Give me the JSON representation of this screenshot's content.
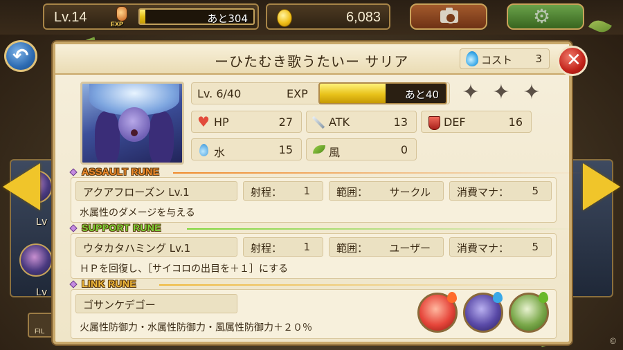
{
  "hud": {
    "level": "Lv.14",
    "exp_icon_label": "EXP",
    "exp_remaining": "あと304",
    "exp_fill_fraction": 0.05,
    "coins": "6,083"
  },
  "background": {
    "left_levels": [
      "Lv",
      "Lv"
    ],
    "filter_label": "FIL"
  },
  "card": {
    "title": "ーひたむき歌うたいー サリア",
    "cost_label": "コスト",
    "cost_value": "3",
    "level": "Lv. 6/40",
    "exp_label": "EXP",
    "exp_remaining": "あと40",
    "exp_fill_fraction": 0.52,
    "stars_filled": 0,
    "stars_total": 3,
    "stats": {
      "hp_label": "HP",
      "hp_value": "27",
      "atk_label": "ATK",
      "atk_value": "13",
      "def_label": "DEF",
      "def_value": "16",
      "water_label": "水",
      "water_value": "15",
      "wind_label": "風",
      "wind_value": "0"
    }
  },
  "assault_rune": {
    "tag": "ASSAULT RUNE",
    "name": "アクアフローズン Lv.1",
    "range_label": "射程：",
    "range_value": "1",
    "area_label": "範囲：",
    "area_value": "サークル",
    "mana_label": "消費マナ：",
    "mana_value": "5",
    "description": "水属性のダメージを与える"
  },
  "support_rune": {
    "tag": "SUPPORT RUNE",
    "name": "ウタカタハミング Lv.1",
    "range_label": "射程：",
    "range_value": "1",
    "area_label": "範囲：",
    "area_value": "ユーザー",
    "mana_label": "消費マナ：",
    "mana_value": "5",
    "description": "ＨＰを回復し、［サイコロの出目を＋１］にする"
  },
  "link_rune": {
    "tag": "LINK RUNE",
    "name": "ゴサンケデゴー",
    "description": "火属性防御力・水属性防御力・風属性防御力＋２０％"
  },
  "colors": {
    "assault_tag": "#f08a2a",
    "support_tag": "#7ed63a",
    "link_tag": "#f0b83a"
  },
  "icons": {
    "back": "back-arrow-icon",
    "close": "close-x-icon",
    "camera": "camera-icon",
    "settings": "gear-icon",
    "coin": "coin-icon",
    "cost": "water-drop-icon"
  },
  "watermark": "©"
}
